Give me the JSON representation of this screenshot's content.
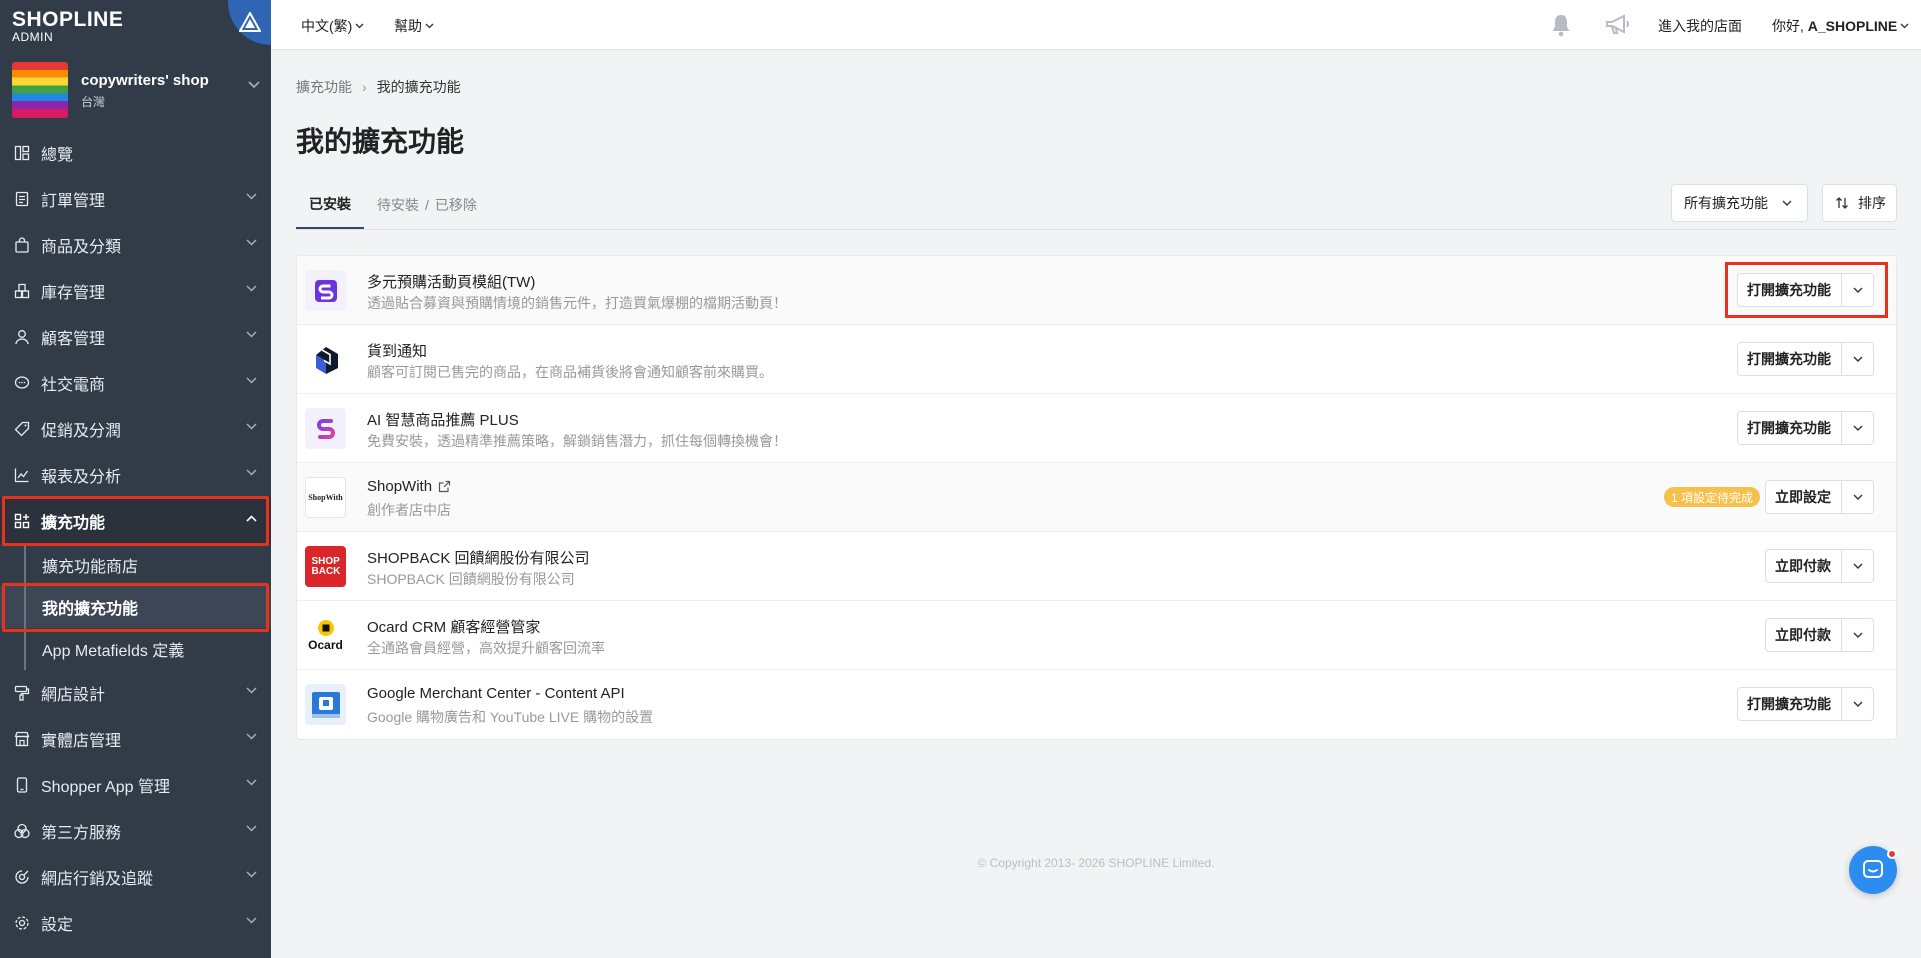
{
  "brand": {
    "name": "SHOPLINE",
    "sub": "ADMIN"
  },
  "shop": {
    "name": "copywriters' shop",
    "region": "台灣"
  },
  "nav": [
    {
      "label": "總覽",
      "icon": "dashboard-icon"
    },
    {
      "label": "訂單管理",
      "icon": "order-icon"
    },
    {
      "label": "商品及分類",
      "icon": "product-bag-icon"
    },
    {
      "label": "庫存管理",
      "icon": "inventory-icon"
    },
    {
      "label": "顧客管理",
      "icon": "customer-icon"
    },
    {
      "label": "社交電商",
      "icon": "chat-bubble-icon"
    },
    {
      "label": "促銷及分潤",
      "icon": "tag-icon"
    },
    {
      "label": "報表及分析",
      "icon": "chart-icon"
    },
    {
      "label": "擴充功能",
      "icon": "apps-icon"
    },
    {
      "label": "網店設計",
      "icon": "paint-roller-icon"
    },
    {
      "label": "實體店管理",
      "icon": "store-icon"
    },
    {
      "label": "Shopper App 管理",
      "icon": "mobile-icon"
    },
    {
      "label": "第三方服務",
      "icon": "puzzle-icon"
    },
    {
      "label": "網店行銷及追蹤",
      "icon": "marketing-icon"
    },
    {
      "label": "設定",
      "icon": "gear-icon"
    }
  ],
  "subnav": [
    {
      "label": "擴充功能商店"
    },
    {
      "label": "我的擴充功能"
    },
    {
      "label": "App Metafields 定義"
    }
  ],
  "topbar": {
    "language": "中文(繁)",
    "help": "幫助",
    "store_link": "進入我的店面",
    "greeting_prefix": "你好, ",
    "user": "A_SHOPLINE"
  },
  "breadcrumb": {
    "parent": "擴充功能",
    "current": "我的擴充功能"
  },
  "page": {
    "title": "我的擴充功能",
    "tabs": [
      "已安裝",
      "待安裝",
      "已移除"
    ],
    "tab_sep": "/",
    "filter": "所有擴充功能",
    "sort": "排序"
  },
  "apps": [
    {
      "name": "多元預購活動頁模組(TW)",
      "desc": "透過貼合募資與預購情境的銷售元件，打造買氣爆棚的檔期活動頁！",
      "action": "打開擴充功能"
    },
    {
      "name": "貨到通知",
      "desc": "顧客可訂閱已售完的商品，在商品補貨後將會通知顧客前來購買。",
      "action": "打開擴充功能"
    },
    {
      "name": "AI 智慧商品推薦 PLUS",
      "desc": "免費安裝，透過精準推薦策略，解鎖銷售潛力，抓住每個轉換機會！",
      "action": "打開擴充功能"
    },
    {
      "name": "ShopWith",
      "desc": "創作者店中店",
      "action": "立即設定",
      "badge": "1 項設定待完成",
      "icon_text": "ShopWith"
    },
    {
      "name": "SHOPBACK 回饋網股份有限公司",
      "desc": "SHOPBACK 回饋網股份有限公司",
      "action": "立即付款",
      "icon_text": "SHOP BACK"
    },
    {
      "name": "Ocard CRM 顧客經營管家",
      "desc": "全通路會員經營，高效提升顧客回流率",
      "action": "立即付款",
      "icon_text": "Ocard"
    },
    {
      "name": "Google Merchant Center - Content API",
      "desc": "Google 購物廣告和 YouTube LIVE 購物的設置",
      "action": "打開擴充功能"
    }
  ],
  "footer": "© Copyright 2013- 2026 SHOPLINE Limited.",
  "colors": {
    "sidebar": "#323b48",
    "highlight": "#e8331c",
    "badge": "#f7c04b",
    "chat": "#2d8cf0"
  }
}
